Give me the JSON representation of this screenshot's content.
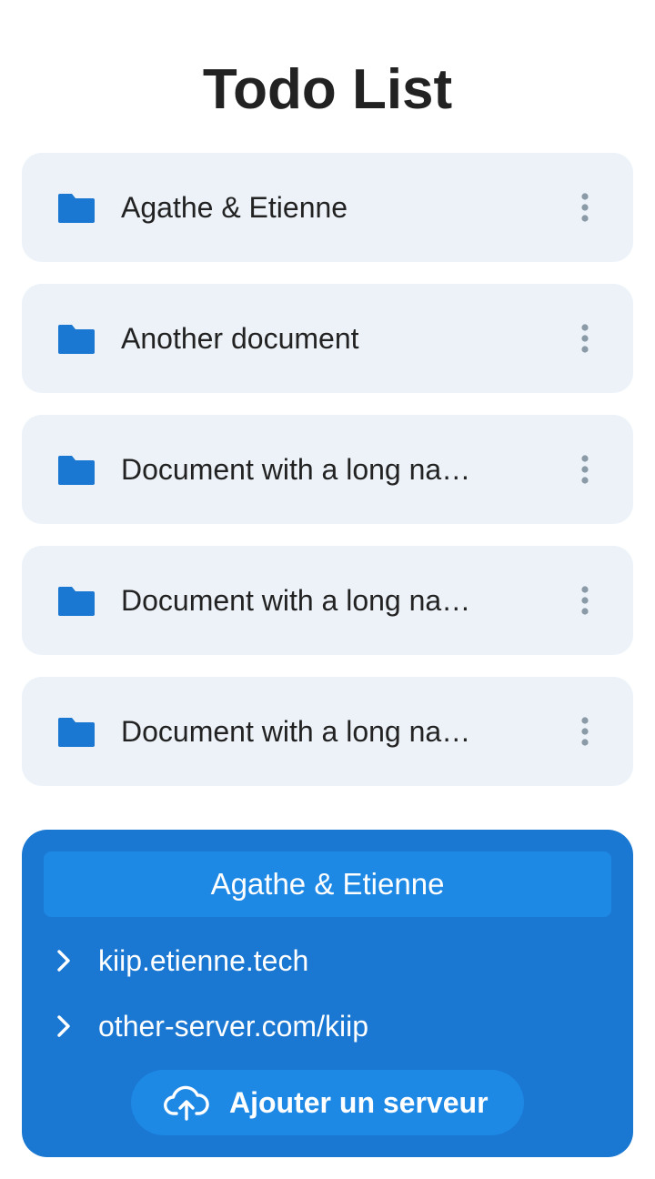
{
  "header": {
    "title": "Todo List"
  },
  "documents": [
    {
      "name": "Agathe & Etienne"
    },
    {
      "name": "Another document"
    },
    {
      "name": "Document with a long na…"
    },
    {
      "name": "Document with a long na…"
    },
    {
      "name": "Document with a long na…"
    }
  ],
  "server_panel": {
    "account_label": "Agathe & Etienne",
    "servers": [
      {
        "url": "kiip.etienne.tech"
      },
      {
        "url": "other-server.com/kiip"
      }
    ],
    "add_button_label": "Ajouter un serveur"
  },
  "colors": {
    "accent": "#1a77d2",
    "accent_light": "#1e88e5",
    "card_bg": "#ecf2f8",
    "more_dots": "#8a9aa6"
  },
  "icons": {
    "document": "folder-icon",
    "menu": "more-vertical-icon",
    "server": "chevron-right-icon",
    "add_server": "cloud-upload-icon"
  }
}
